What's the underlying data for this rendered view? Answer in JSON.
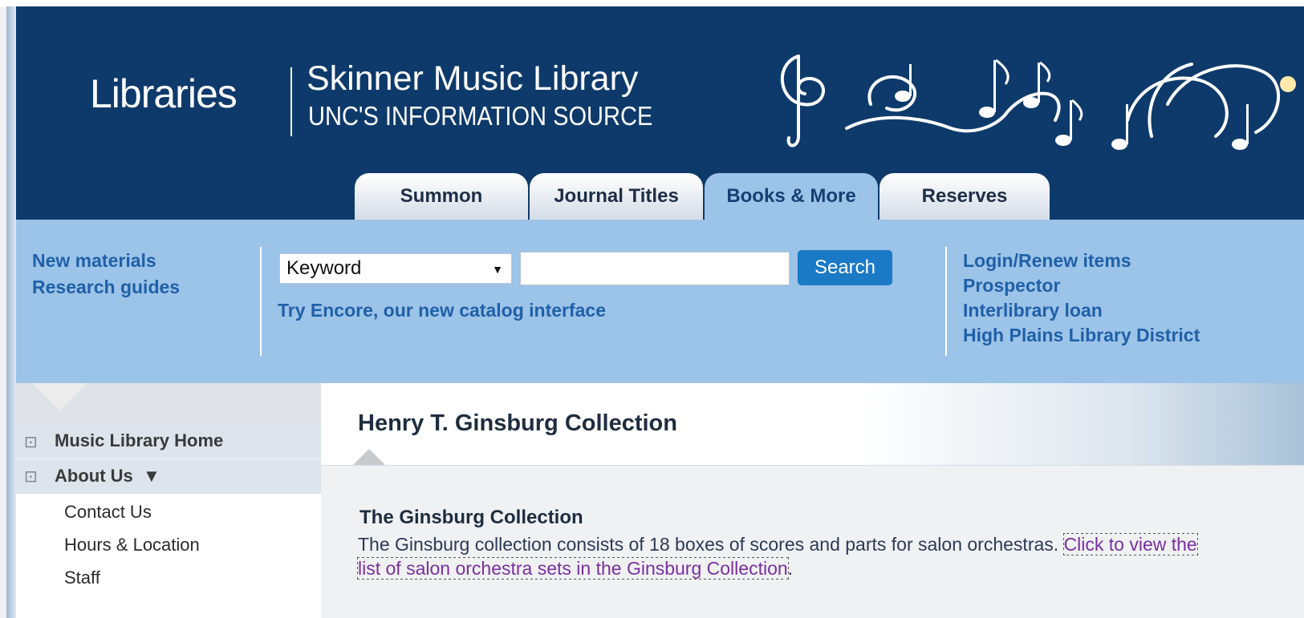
{
  "header": {
    "logo_text": "Libraries",
    "site_title": "Skinner Music Library",
    "site_subtitle": "UNC'S INFORMATION SOURCE"
  },
  "tabs": [
    {
      "label": "Summon",
      "active": false
    },
    {
      "label": "Journal Titles",
      "active": false
    },
    {
      "label": "Books & More",
      "active": true
    },
    {
      "label": "Reserves",
      "active": false
    }
  ],
  "search": {
    "left_links": [
      "New materials",
      "Research guides"
    ],
    "select_value": "Keyword",
    "input_value": "",
    "button_label": "Search",
    "encore_link": "Try Encore, our new catalog interface",
    "right_links": [
      "Login/Renew items",
      "Prospector",
      "Interlibrary loan",
      "High Plains Library District"
    ]
  },
  "sidebar": {
    "items": [
      {
        "label": "Music Library Home"
      },
      {
        "label": "About Us",
        "expanded_marker": "▼"
      }
    ],
    "sub_items": [
      "Contact Us",
      "Hours & Location",
      "Staff"
    ]
  },
  "content": {
    "page_title": "Henry T. Ginsburg Collection",
    "section_title": "The Ginsburg Collection",
    "paragraph_text": "The Ginsburg collection consists of 18 boxes of scores and parts for salon orchestras. ",
    "paragraph_link": "Click to view the list of salon orchestra sets in the Ginsburg Collection",
    "paragraph_end": "."
  },
  "icons": {
    "nav_item": "external-page-icon",
    "dropdown": "caret-down-icon",
    "ornament": "music-notes-ornament"
  },
  "colors": {
    "header_bg": "#0e3a6b",
    "search_panel_bg": "#9cc3e8",
    "link_blue": "#1f60a8",
    "button_blue": "#1a7ac6",
    "visited_link": "#7a2fa0"
  }
}
